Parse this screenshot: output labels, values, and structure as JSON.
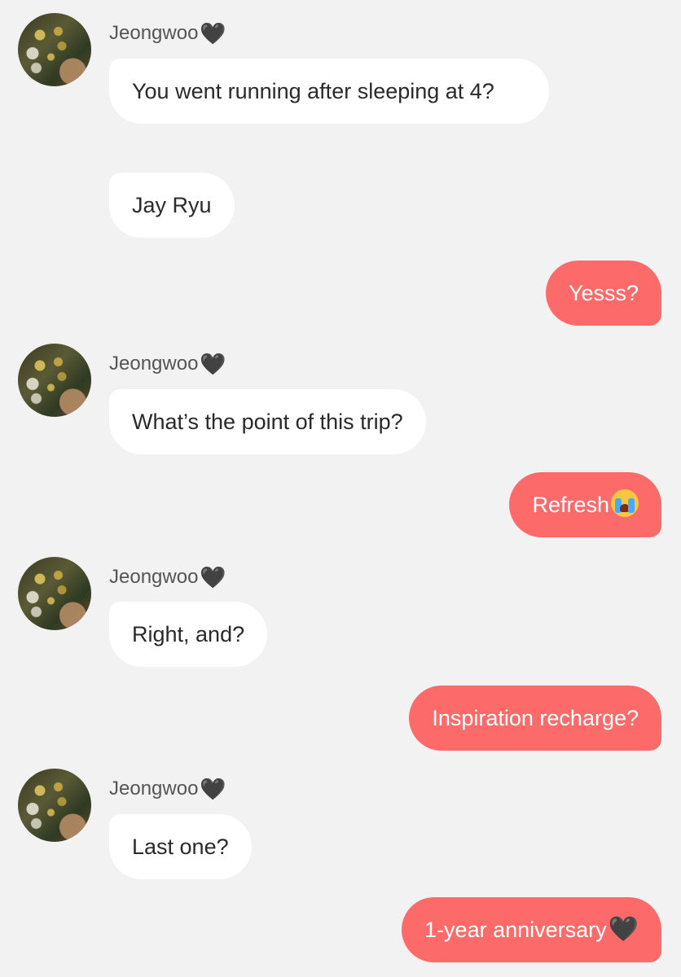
{
  "contact": {
    "name": "Jeongwoo",
    "name_emoji": "🖤"
  },
  "messages": [
    {
      "from": "contact",
      "text": "You went running after sleeping at 4?"
    },
    {
      "from": "contact",
      "text": "Jay Ryu"
    },
    {
      "from": "me",
      "text": "Yesss?"
    },
    {
      "from": "contact",
      "text": "What’s the point of this trip?"
    },
    {
      "from": "me",
      "text": "Refresh",
      "emoji": "crying-face"
    },
    {
      "from": "contact",
      "text": "Right, and?"
    },
    {
      "from": "me",
      "text": "Inspiration recharge?"
    },
    {
      "from": "contact",
      "text": "Last one?"
    },
    {
      "from": "me",
      "text": "1-year anniversary",
      "emoji": "🖤"
    }
  ],
  "colors": {
    "background": "#f2f2f2",
    "incoming_bubble": "#ffffff",
    "outgoing_bubble": "#fd6a6a",
    "name_text": "#555555"
  }
}
